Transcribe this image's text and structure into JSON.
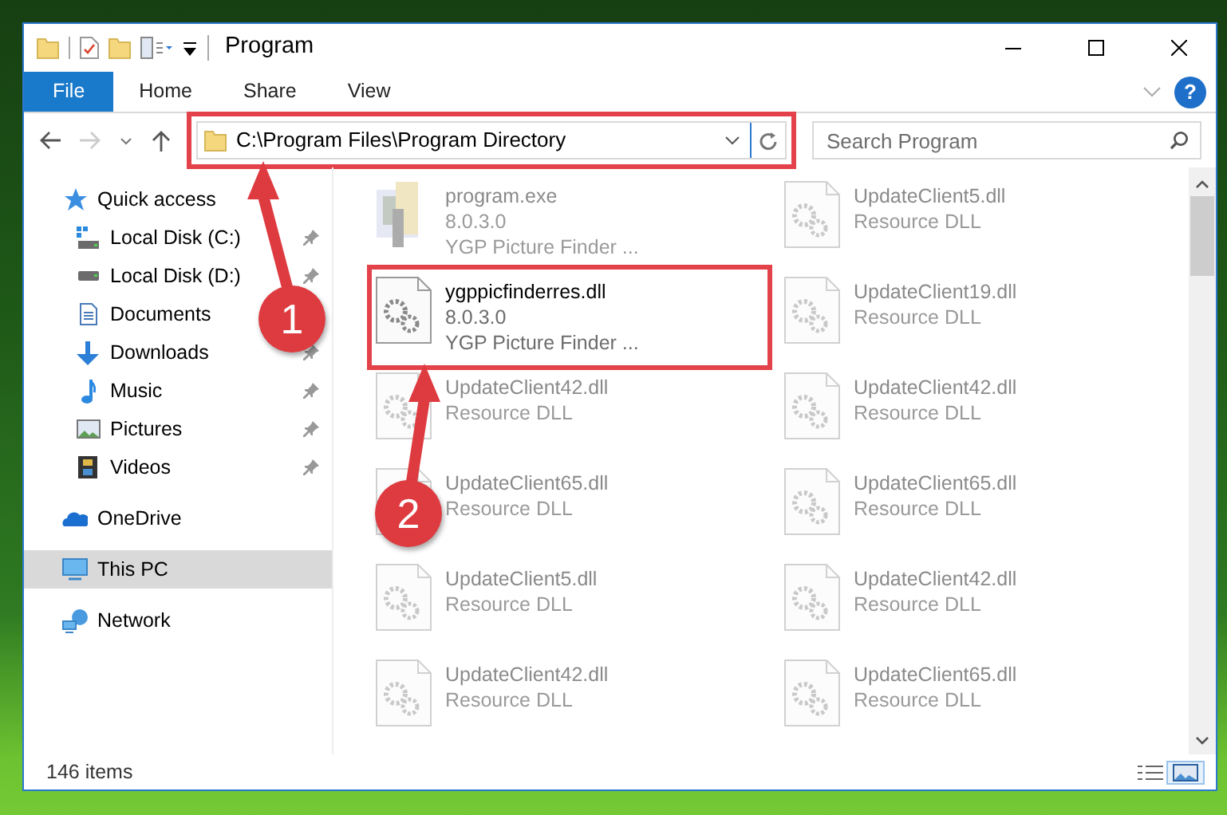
{
  "window": {
    "title": "Program"
  },
  "ribbon": {
    "tabs": [
      {
        "label": "File",
        "selected": true
      },
      {
        "label": "Home",
        "selected": false
      },
      {
        "label": "Share",
        "selected": false
      },
      {
        "label": "View",
        "selected": false
      }
    ],
    "help_label": "?"
  },
  "address_bar": {
    "path": "C:\\Program Files\\Program Directory"
  },
  "search": {
    "placeholder": "Search Program"
  },
  "sidebar": {
    "items": [
      {
        "label": "Quick access",
        "selected": false,
        "children": [
          {
            "label": "Local Disk (C:)",
            "pinned": true
          },
          {
            "label": "Local Disk (D:)",
            "pinned": true
          },
          {
            "label": "Documents",
            "pinned": false
          },
          {
            "label": "Downloads",
            "pinned": true
          },
          {
            "label": "Music",
            "pinned": true
          },
          {
            "label": "Pictures",
            "pinned": true
          },
          {
            "label": "Videos",
            "pinned": true
          }
        ]
      },
      {
        "label": "OneDrive",
        "selected": false
      },
      {
        "label": "This PC",
        "selected": true
      },
      {
        "label": "Network",
        "selected": false
      }
    ]
  },
  "files": {
    "columns": [
      [
        {
          "name": "program.exe",
          "lines": [
            "8.0.3.0",
            "YGP Picture Finder ..."
          ],
          "kind": "app",
          "blurred": true
        },
        {
          "name": "ygppicfinderres.dll",
          "lines": [
            "8.0.3.0",
            "YGP Picture Finder ..."
          ],
          "kind": "dll",
          "blurred": false
        },
        {
          "name": "UpdateClient42.dll",
          "lines": [
            "Resource DLL"
          ],
          "kind": "dll",
          "blurred": true
        },
        {
          "name": "UpdateClient65.dll",
          "lines": [
            "Resource DLL"
          ],
          "kind": "dll",
          "blurred": true
        },
        {
          "name": "UpdateClient5.dll",
          "lines": [
            "Resource DLL"
          ],
          "kind": "dll",
          "blurred": true
        },
        {
          "name": "UpdateClient42.dll",
          "lines": [
            "Resource DLL"
          ],
          "kind": "dll",
          "blurred": true
        }
      ],
      [
        {
          "name": "UpdateClient5.dll",
          "lines": [
            "Resource DLL"
          ],
          "kind": "dll",
          "blurred": true
        },
        {
          "name": "UpdateClient19.dll",
          "lines": [
            "Resource DLL"
          ],
          "kind": "dll",
          "blurred": true
        },
        {
          "name": "UpdateClient42.dll",
          "lines": [
            "Resource DLL"
          ],
          "kind": "dll",
          "blurred": true
        },
        {
          "name": "UpdateClient65.dll",
          "lines": [
            "Resource DLL"
          ],
          "kind": "dll",
          "blurred": true
        },
        {
          "name": "UpdateClient42.dll",
          "lines": [
            "Resource DLL"
          ],
          "kind": "dll",
          "blurred": true
        },
        {
          "name": "UpdateClient65.dll",
          "lines": [
            "Resource DLL"
          ],
          "kind": "dll",
          "blurred": true
        }
      ]
    ]
  },
  "status_bar": {
    "item_count": "146 items",
    "views": [
      {
        "kind": "details",
        "selected": false
      },
      {
        "kind": "large-icons",
        "selected": true
      }
    ]
  },
  "annotations": [
    {
      "label": "1"
    },
    {
      "label": "2"
    }
  ]
}
